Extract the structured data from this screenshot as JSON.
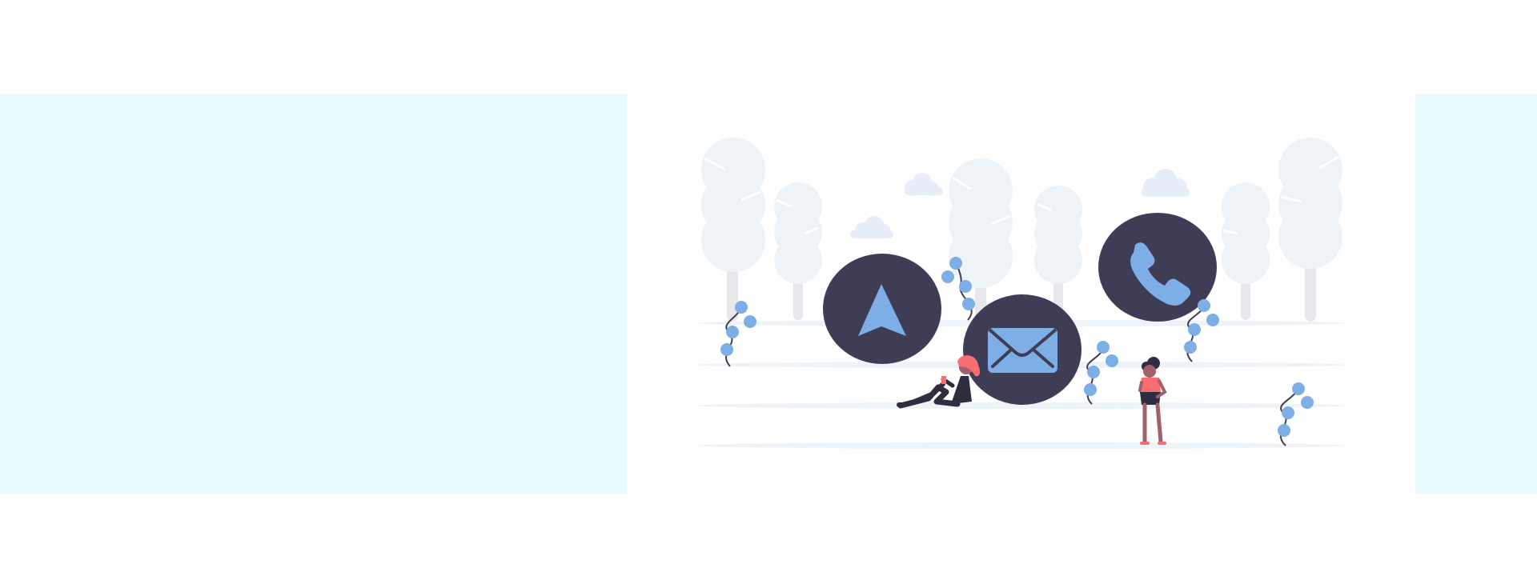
{
  "page": {
    "background": "#ffffff",
    "band_color": "#eafcfe",
    "panel_color": "#ffffff"
  },
  "illustration": {
    "theme": "contact",
    "colors": {
      "circle_fill": "#3f3d56",
      "icon_fill": "#7daee6",
      "tree": "#eef3f8",
      "trunk": "#e8e8ec",
      "cloud": "#e7eef8",
      "ground_line": "#eef3f8",
      "plant_leaf": "#7daee6",
      "plant_stem": "#3f3d56",
      "person_hair": "#f86d70",
      "person_dark": "#2f2e41",
      "person_skin": "#a0616a"
    },
    "icons": [
      "navigation-arrow-icon",
      "envelope-icon",
      "phone-icon"
    ]
  }
}
